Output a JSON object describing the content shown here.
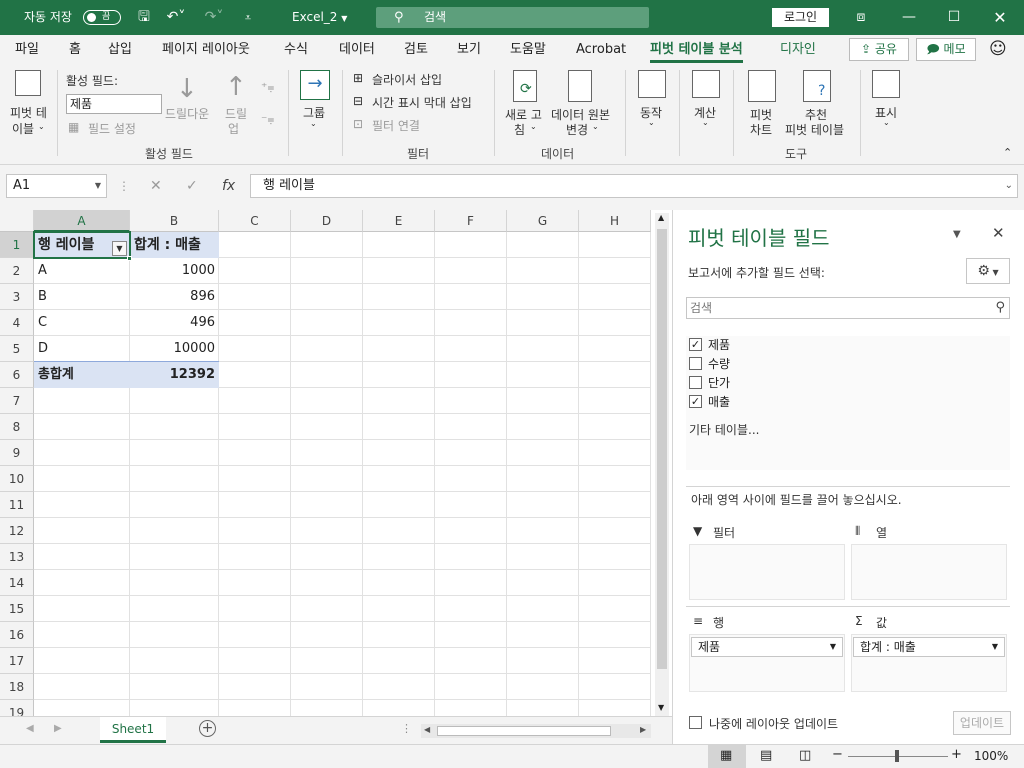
{
  "titlebar": {
    "autosave_label": "자동 저장",
    "autosave_state": "끔",
    "filename": "Excel_2",
    "search_placeholder": "검색",
    "login_label": "로그인"
  },
  "tabs": {
    "items": [
      "파일",
      "홈",
      "삽입",
      "페이지 레이아웃",
      "수식",
      "데이터",
      "검토",
      "보기",
      "도움말",
      "Acrobat",
      "피벗 테이블 분석",
      "디자인"
    ],
    "share_label": "공유",
    "memo_label": "메모"
  },
  "ribbon": {
    "pivot_table_line1": "피벗 테",
    "pivot_table_line2": "이블",
    "active_field_label": "활성 필드:",
    "active_field_value": "제품",
    "field_settings": "필드 설정",
    "drill_down": "드릴다운",
    "drill_up_line1": "드릴",
    "drill_up_line2": "업",
    "group_label": "그룹",
    "insert_slicer": "슬라이서 삽입",
    "insert_timeline": "시간 표시 막대 삽입",
    "filter_connections": "필터 연결",
    "refresh_line1": "새로 고",
    "refresh_line2": "침",
    "change_source_line1": "데이터 원본",
    "change_source_line2": "변경",
    "actions_label": "동작",
    "calculations_label": "계산",
    "pivotchart_line1": "피벗",
    "pivotchart_line2": "차트",
    "recommended_line1": "추천",
    "recommended_line2": "피벗 테이블",
    "show_label": "표시",
    "groups": {
      "active_field": "활성 필드",
      "filter": "필터",
      "data": "데이터",
      "tools": "도구"
    }
  },
  "formula_bar": {
    "name_box": "A1",
    "content": "행 레이블"
  },
  "grid": {
    "columns": [
      "A",
      "B",
      "C",
      "D",
      "E",
      "F",
      "G",
      "H"
    ],
    "rows": [
      "1",
      "2",
      "3",
      "4",
      "5",
      "6",
      "7",
      "8",
      "9",
      "10",
      "11",
      "12",
      "13",
      "14",
      "15",
      "16",
      "17",
      "18",
      "19"
    ],
    "pivot": {
      "header_row_label": "행 레이블",
      "header_value": "합계 : 매출",
      "rows": [
        {
          "label": "A",
          "value": "1000"
        },
        {
          "label": "B",
          "value": "896"
        },
        {
          "label": "C",
          "value": "496"
        },
        {
          "label": "D",
          "value": "10000"
        }
      ],
      "total_label": "총합계",
      "total_value": "12392"
    }
  },
  "sheets": {
    "active": "Sheet1"
  },
  "status": {
    "zoom": "100%"
  },
  "pivot_pane": {
    "title": "피벗 테이블 필드",
    "subtitle": "보고서에 추가할 필드 선택:",
    "search_placeholder": "검색",
    "fields": [
      {
        "name": "제품",
        "checked": true
      },
      {
        "name": "수량",
        "checked": false
      },
      {
        "name": "단가",
        "checked": false
      },
      {
        "name": "매출",
        "checked": true
      }
    ],
    "more_tables": "기타 테이블...",
    "drag_hint": "아래 영역 사이에 필드를 끌어 놓으십시오.",
    "areas": {
      "filter": "필터",
      "columns": "열",
      "rows": "행",
      "values": "값"
    },
    "rows_field": "제품",
    "values_field": "합계 : 매출",
    "defer_update": "나중에 레이아웃 업데이트",
    "update_button": "업데이트"
  },
  "colors": {
    "brand": "#217346",
    "pivot_header": "#dae3f3"
  }
}
